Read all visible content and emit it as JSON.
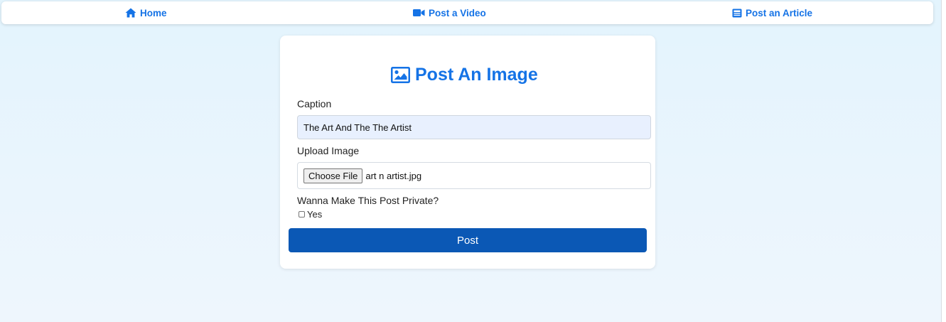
{
  "nav": {
    "home_label": "Home",
    "home_icon": "home-icon",
    "video_label": "Post a Video",
    "video_icon": "video-camera-icon",
    "article_label": "Post an Article",
    "article_icon": "newspaper-icon"
  },
  "form": {
    "title": "Post An Image",
    "title_icon": "image-icon",
    "caption_label": "Caption",
    "caption_value": "The Art And The The Artist",
    "upload_label": "Upload Image",
    "choose_file_label": "Choose File",
    "file_name": "art n artist.jpg",
    "private_label": "Wanna Make This Post Private?",
    "private_option": "Yes",
    "private_checked": false,
    "submit_label": "Post"
  },
  "colors": {
    "accent": "#1573e6",
    "button": "#0b58b5",
    "input_bg": "#e8f0fe",
    "page_bg": "#e6f4fd"
  }
}
